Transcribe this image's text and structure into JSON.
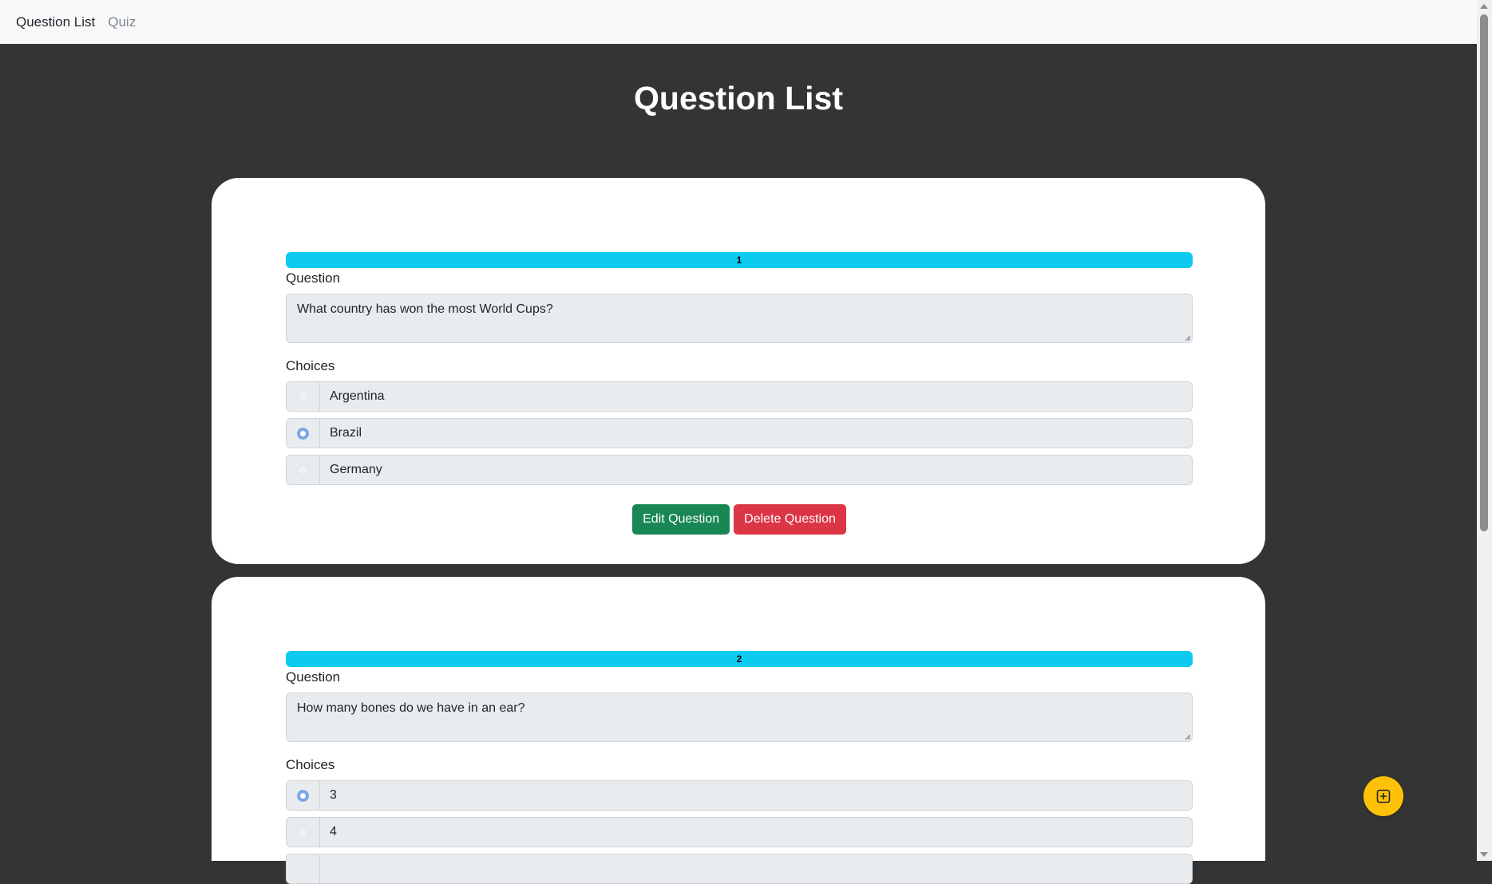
{
  "nav": {
    "items": [
      {
        "label": "Question List",
        "active": true
      },
      {
        "label": "Quiz",
        "active": false
      }
    ]
  },
  "page": {
    "title": "Question List"
  },
  "questions": [
    {
      "number": "1",
      "question_label": "Question",
      "question_text": "What country has won the most World Cups?",
      "choices_label": "Choices",
      "choices": [
        {
          "label": "Argentina",
          "selected": false
        },
        {
          "label": "Brazil",
          "selected": true
        },
        {
          "label": "Germany",
          "selected": false
        }
      ],
      "edit_label": "Edit Question",
      "delete_label": "Delete Question"
    },
    {
      "number": "2",
      "question_label": "Question",
      "question_text": "How many bones do we have in an ear?",
      "choices_label": "Choices",
      "choices": [
        {
          "label": "3",
          "selected": true
        },
        {
          "label": "4",
          "selected": false
        }
      ]
    }
  ],
  "fab": {
    "icon": "plus-square-icon"
  },
  "colors": {
    "background": "#343434",
    "navbar": "#f8f9fa",
    "progress": "#0dcaf0",
    "edit": "#198754",
    "delete": "#dc3545",
    "fab": "#ffc107",
    "radio_checked": "#7aa7e6"
  }
}
